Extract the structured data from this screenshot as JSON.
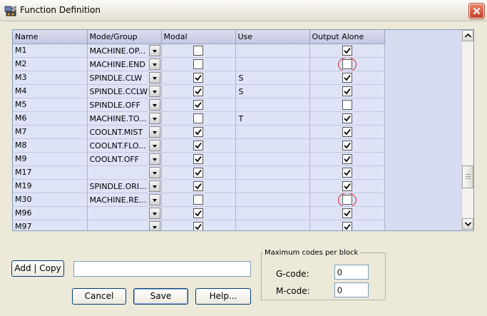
{
  "window": {
    "title": "Function Definition"
  },
  "grid": {
    "columns": [
      "Name",
      "Mode/Group",
      "Modal",
      "Use",
      "Output Alone"
    ],
    "rows": [
      {
        "name": "M1",
        "mode": "MACHINE.OP...",
        "modal": false,
        "use": "",
        "output_alone": true,
        "highlight": false
      },
      {
        "name": "M2",
        "mode": "MACHINE.END",
        "modal": false,
        "use": "",
        "output_alone": false,
        "highlight": true
      },
      {
        "name": "M3",
        "mode": "SPINDLE.CLW",
        "modal": true,
        "use": "S",
        "output_alone": true,
        "highlight": false
      },
      {
        "name": "M4",
        "mode": "SPINDLE.CCLW",
        "modal": true,
        "use": "S",
        "output_alone": true,
        "highlight": false
      },
      {
        "name": "M5",
        "mode": "SPINDLE.OFF",
        "modal": true,
        "use": "",
        "output_alone": false,
        "highlight": false
      },
      {
        "name": "M6",
        "mode": "MACHINE.TO...",
        "modal": false,
        "use": "T",
        "output_alone": true,
        "highlight": false
      },
      {
        "name": "M7",
        "mode": "COOLNT.MIST",
        "modal": true,
        "use": "",
        "output_alone": true,
        "highlight": false
      },
      {
        "name": "M8",
        "mode": "COOLNT.FLO...",
        "modal": true,
        "use": "",
        "output_alone": true,
        "highlight": false
      },
      {
        "name": "M9",
        "mode": "COOLNT.OFF",
        "modal": true,
        "use": "",
        "output_alone": true,
        "highlight": false
      },
      {
        "name": "M17",
        "mode": "",
        "modal": true,
        "use": "",
        "output_alone": true,
        "highlight": false
      },
      {
        "name": "M19",
        "mode": "SPINDLE.ORI...",
        "modal": true,
        "use": "",
        "output_alone": true,
        "highlight": false
      },
      {
        "name": "M30",
        "mode": "MACHINE.RE...",
        "modal": false,
        "use": "",
        "output_alone": false,
        "highlight": true
      },
      {
        "name": "M96",
        "mode": "",
        "modal": true,
        "use": "",
        "output_alone": true,
        "highlight": false
      },
      {
        "name": "M97",
        "mode": "",
        "modal": true,
        "use": "",
        "output_alone": true,
        "highlight": false
      }
    ]
  },
  "controls": {
    "add_copy_label": "Add | Copy",
    "text_value": "",
    "cancel_label": "Cancel",
    "save_label": "Save",
    "help_label": "Help..."
  },
  "max_codes": {
    "legend": "Maximum codes per block",
    "g_label": "G-code:",
    "g_value": "0",
    "m_label": "M-code:",
    "m_value": "0"
  },
  "colors": {
    "highlight_ring": "#d42020",
    "grid_background": "#dfe3f6",
    "close_button": "#c4432b"
  }
}
